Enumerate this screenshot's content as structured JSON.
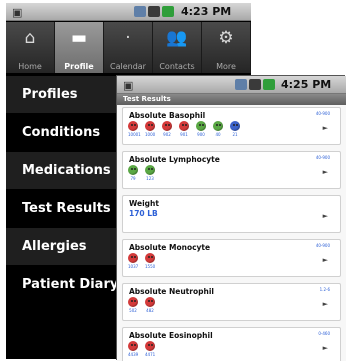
{
  "colors": {
    "red_dot": "#d43a3a",
    "green_dot": "#5aa844",
    "blue_dot": "#3d63c9",
    "link_blue": "#2d60d6"
  },
  "back_screen": {
    "status": {
      "time": "4:23 PM"
    },
    "tabs": [
      {
        "label": "Home",
        "icon": "house-icon",
        "glyph": "⌂"
      },
      {
        "label": "Profile",
        "icon": "profile-card-icon",
        "glyph": "▬"
      },
      {
        "label": "Calendar",
        "icon": "calendar-icon",
        "glyph": "·"
      },
      {
        "label": "Contacts",
        "icon": "contacts-icon",
        "glyph": "👥"
      },
      {
        "label": "More",
        "icon": "gear-icon",
        "glyph": "⚙"
      }
    ],
    "menu": [
      "Profiles",
      "Conditions",
      "Medications",
      "Test Results",
      "Allergies",
      "Patient Diary"
    ]
  },
  "front_screen": {
    "status": {
      "time": "4:25 PM"
    },
    "title": "Test Results",
    "results": [
      {
        "name": "Absolute Basophil",
        "range": "40-900",
        "dots": [
          {
            "color": "red",
            "value": "10001"
          },
          {
            "color": "red",
            "value": "1000"
          },
          {
            "color": "red",
            "value": "902"
          },
          {
            "color": "red",
            "value": "901"
          },
          {
            "color": "green",
            "value": "900"
          },
          {
            "color": "green",
            "value": "40"
          },
          {
            "color": "blue",
            "value": "21"
          }
        ]
      },
      {
        "name": "Absolute Lymphocyte",
        "range": "40-900",
        "dots": [
          {
            "color": "green",
            "value": "79"
          },
          {
            "color": "green",
            "value": "123"
          }
        ]
      },
      {
        "name": "Weight",
        "value": "170 LB"
      },
      {
        "name": "Absolute Monocyte",
        "range": "40-900",
        "dots": [
          {
            "color": "red",
            "value": "1037"
          },
          {
            "color": "red",
            "value": "1550"
          }
        ]
      },
      {
        "name": "Absolute Neutrophil",
        "range": "1.2-6",
        "dots": [
          {
            "color": "red",
            "value": "502"
          },
          {
            "color": "red",
            "value": "482"
          }
        ]
      },
      {
        "name": "Absolute Eosinophil",
        "range": "0-460",
        "dots": [
          {
            "color": "red",
            "value": "4439"
          },
          {
            "color": "red",
            "value": "4471"
          }
        ]
      }
    ]
  }
}
